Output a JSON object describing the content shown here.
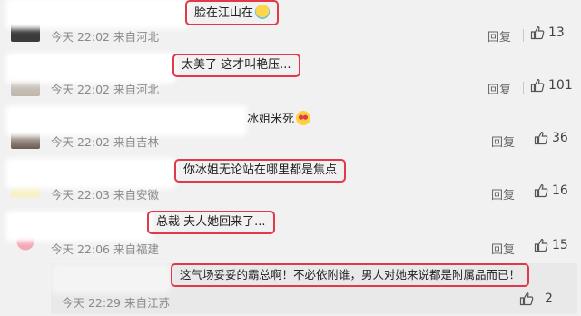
{
  "comments": [
    {
      "text": "脸在江山在",
      "emoji": "crying-laugh-emoji",
      "time": "今天 22:02 来自河北",
      "reply_label": "回复",
      "likes": "13"
    },
    {
      "text": "太美了 这才叫艳压...",
      "time": "今天 22:02 来自河北",
      "reply_label": "回复",
      "likes": "101"
    },
    {
      "text": "冰姐米死",
      "emoji": "heart-eyes-emoji",
      "time": "今天 22:02 来自吉林",
      "reply_label": "回复",
      "likes": "36"
    },
    {
      "text": "你冰姐无论站在哪里都是焦点",
      "time": "今天 22:03 来自安徽",
      "reply_label": "回复",
      "likes": "16"
    },
    {
      "text": "总裁 夫人她回来了...",
      "time": "今天 22:06 来自福建",
      "reply_label": "回复",
      "likes": "15"
    }
  ],
  "sub_reply": {
    "text": "这气场妥妥的霸总啊！不必依附谁，男人对她来说都是附属品而已！",
    "time": "今天 22:29 来自江苏",
    "likes": "2"
  },
  "colors": {
    "highlight": "#e2394a",
    "background": "#f1f1f1"
  }
}
